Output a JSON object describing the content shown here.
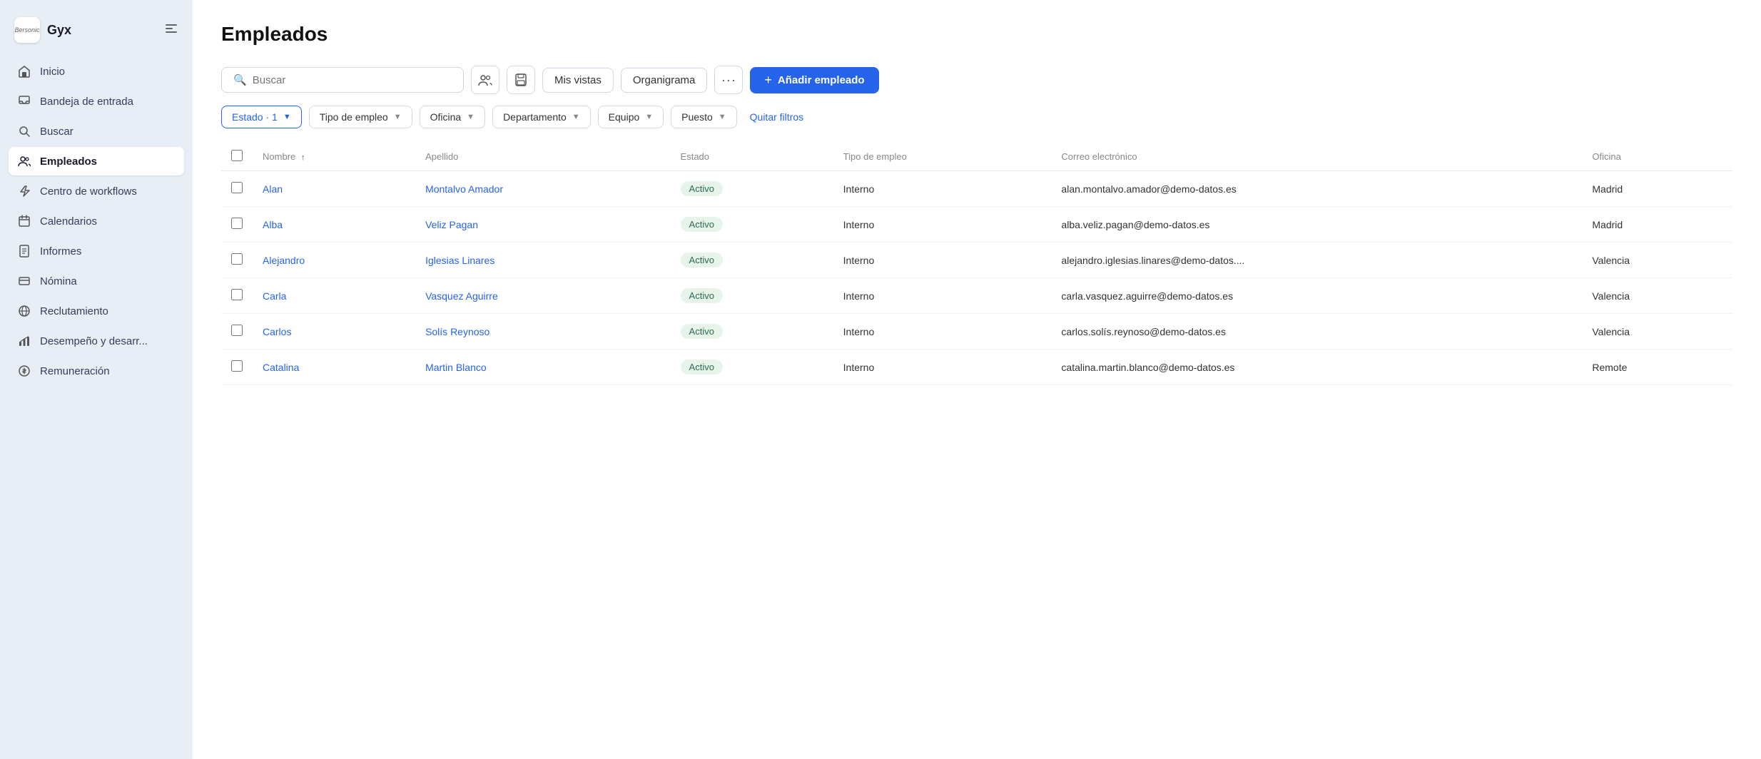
{
  "app": {
    "logo_text": "Bersonic",
    "name": "Gyx"
  },
  "sidebar": {
    "items": [
      {
        "id": "inicio",
        "label": "Inicio",
        "icon": "home"
      },
      {
        "id": "bandeja",
        "label": "Bandeja de entrada",
        "icon": "inbox"
      },
      {
        "id": "buscar",
        "label": "Buscar",
        "icon": "search"
      },
      {
        "id": "empleados",
        "label": "Empleados",
        "icon": "people",
        "active": true
      },
      {
        "id": "workflows",
        "label": "Centro de workflows",
        "icon": "lightning"
      },
      {
        "id": "calendarios",
        "label": "Calendarios",
        "icon": "calendar"
      },
      {
        "id": "informes",
        "label": "Informes",
        "icon": "document"
      },
      {
        "id": "nomina",
        "label": "Nómina",
        "icon": "card"
      },
      {
        "id": "reclutamiento",
        "label": "Reclutamiento",
        "icon": "globe"
      },
      {
        "id": "desempeno",
        "label": "Desempeño y desarr...",
        "icon": "chart"
      },
      {
        "id": "remuneracion",
        "label": "Remuneración",
        "icon": "coins"
      }
    ]
  },
  "page": {
    "title": "Empleados"
  },
  "toolbar": {
    "search_placeholder": "Buscar",
    "mis_vistas_label": "Mis vistas",
    "organigrama_label": "Organigrama",
    "add_employee_label": "Añadir empleado"
  },
  "filters": {
    "estado": {
      "label": "Estado · 1",
      "active": true
    },
    "tipo_empleo": {
      "label": "Tipo de empleo"
    },
    "oficina": {
      "label": "Oficina"
    },
    "departamento": {
      "label": "Departamento"
    },
    "equipo": {
      "label": "Equipo"
    },
    "puesto": {
      "label": "Puesto"
    },
    "clear_label": "Quitar filtros"
  },
  "table": {
    "columns": [
      {
        "id": "nombre",
        "label": "Nombre",
        "sortable": true
      },
      {
        "id": "apellido",
        "label": "Apellido"
      },
      {
        "id": "estado",
        "label": "Estado"
      },
      {
        "id": "tipo_empleo",
        "label": "Tipo de empleo"
      },
      {
        "id": "correo",
        "label": "Correo electrónico"
      },
      {
        "id": "oficina",
        "label": "Oficina"
      }
    ],
    "rows": [
      {
        "nombre": "Alan",
        "apellido": "Montalvo Amador",
        "estado": "Activo",
        "tipo_empleo": "Interno",
        "correo": "alan.montalvo.amador@demo-datos.es",
        "oficina": "Madrid"
      },
      {
        "nombre": "Alba",
        "apellido": "Veliz Pagan",
        "estado": "Activo",
        "tipo_empleo": "Interno",
        "correo": "alba.veliz.pagan@demo-datos.es",
        "oficina": "Madrid"
      },
      {
        "nombre": "Alejandro",
        "apellido": "Iglesias Linares",
        "estado": "Activo",
        "tipo_empleo": "Interno",
        "correo": "alejandro.iglesias.linares@demo-datos....",
        "oficina": "Valencia"
      },
      {
        "nombre": "Carla",
        "apellido": "Vasquez Aguirre",
        "estado": "Activo",
        "tipo_empleo": "Interno",
        "correo": "carla.vasquez.aguirre@demo-datos.es",
        "oficina": "Valencia"
      },
      {
        "nombre": "Carlos",
        "apellido": "Solís Reynoso",
        "estado": "Activo",
        "tipo_empleo": "Interno",
        "correo": "carlos.solís.reynoso@demo-datos.es",
        "oficina": "Valencia"
      },
      {
        "nombre": "Catalina",
        "apellido": "Martin Blanco",
        "estado": "Activo",
        "tipo_empleo": "Interno",
        "correo": "catalina.martin.blanco@demo-datos.es",
        "oficina": "Remote"
      }
    ]
  }
}
